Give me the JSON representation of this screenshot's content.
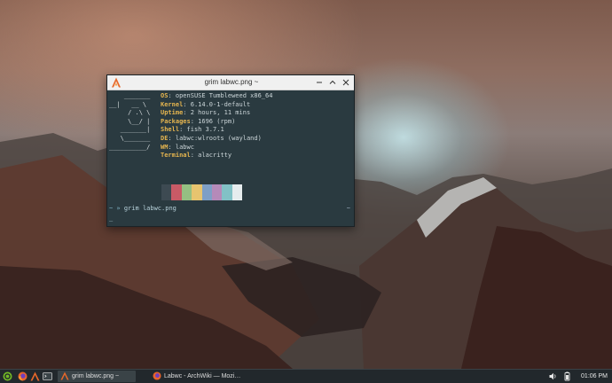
{
  "window": {
    "title": "grim labwc.png ~",
    "app_icon": "alacritty-icon"
  },
  "terminal": {
    "ascii_logo": [
      "    _______",
      "__|   __ \\",
      "     / .\\ \\",
      "     \\__/ |",
      "   _______|",
      "   \\_______",
      "__________/"
    ],
    "info": [
      {
        "key": "OS",
        "sep": ": ",
        "value": "openSUSE Tumbleweed x86_64"
      },
      {
        "key": "Kernel",
        "sep": ": ",
        "value": "6.14.0-1-default"
      },
      {
        "key": "Uptime",
        "sep": ": ",
        "value": "2 hours, 11 mins"
      },
      {
        "key": "Packages",
        "sep": ": ",
        "value": "1696 (rpm)"
      },
      {
        "key": "Shell",
        "sep": ": ",
        "value": "fish 3.7.1"
      },
      {
        "key": "DE",
        "sep": ": ",
        "value": "labwc:wlroots (wayland)"
      },
      {
        "key": "WM",
        "sep": ": ",
        "value": "labwc"
      },
      {
        "key": "Terminal",
        "sep": ": ",
        "value": "alacritty"
      }
    ],
    "palette": [
      "#3d4a52",
      "#c85a66",
      "#95bf82",
      "#e7c46f",
      "#7e9fc6",
      "#b58ab9",
      "#82c1c6",
      "#e6ecee"
    ],
    "prompt_symbol": "~ »",
    "command": "grim labwc.png",
    "prompt_right": "~",
    "cursor": "_"
  },
  "taskbar": {
    "tasks": [
      {
        "label": "grim labwc.png ~",
        "active": true
      },
      {
        "label": "Labwc - ArchWiki — Mozi…",
        "active": false
      }
    ],
    "clock": "01:06 PM"
  }
}
